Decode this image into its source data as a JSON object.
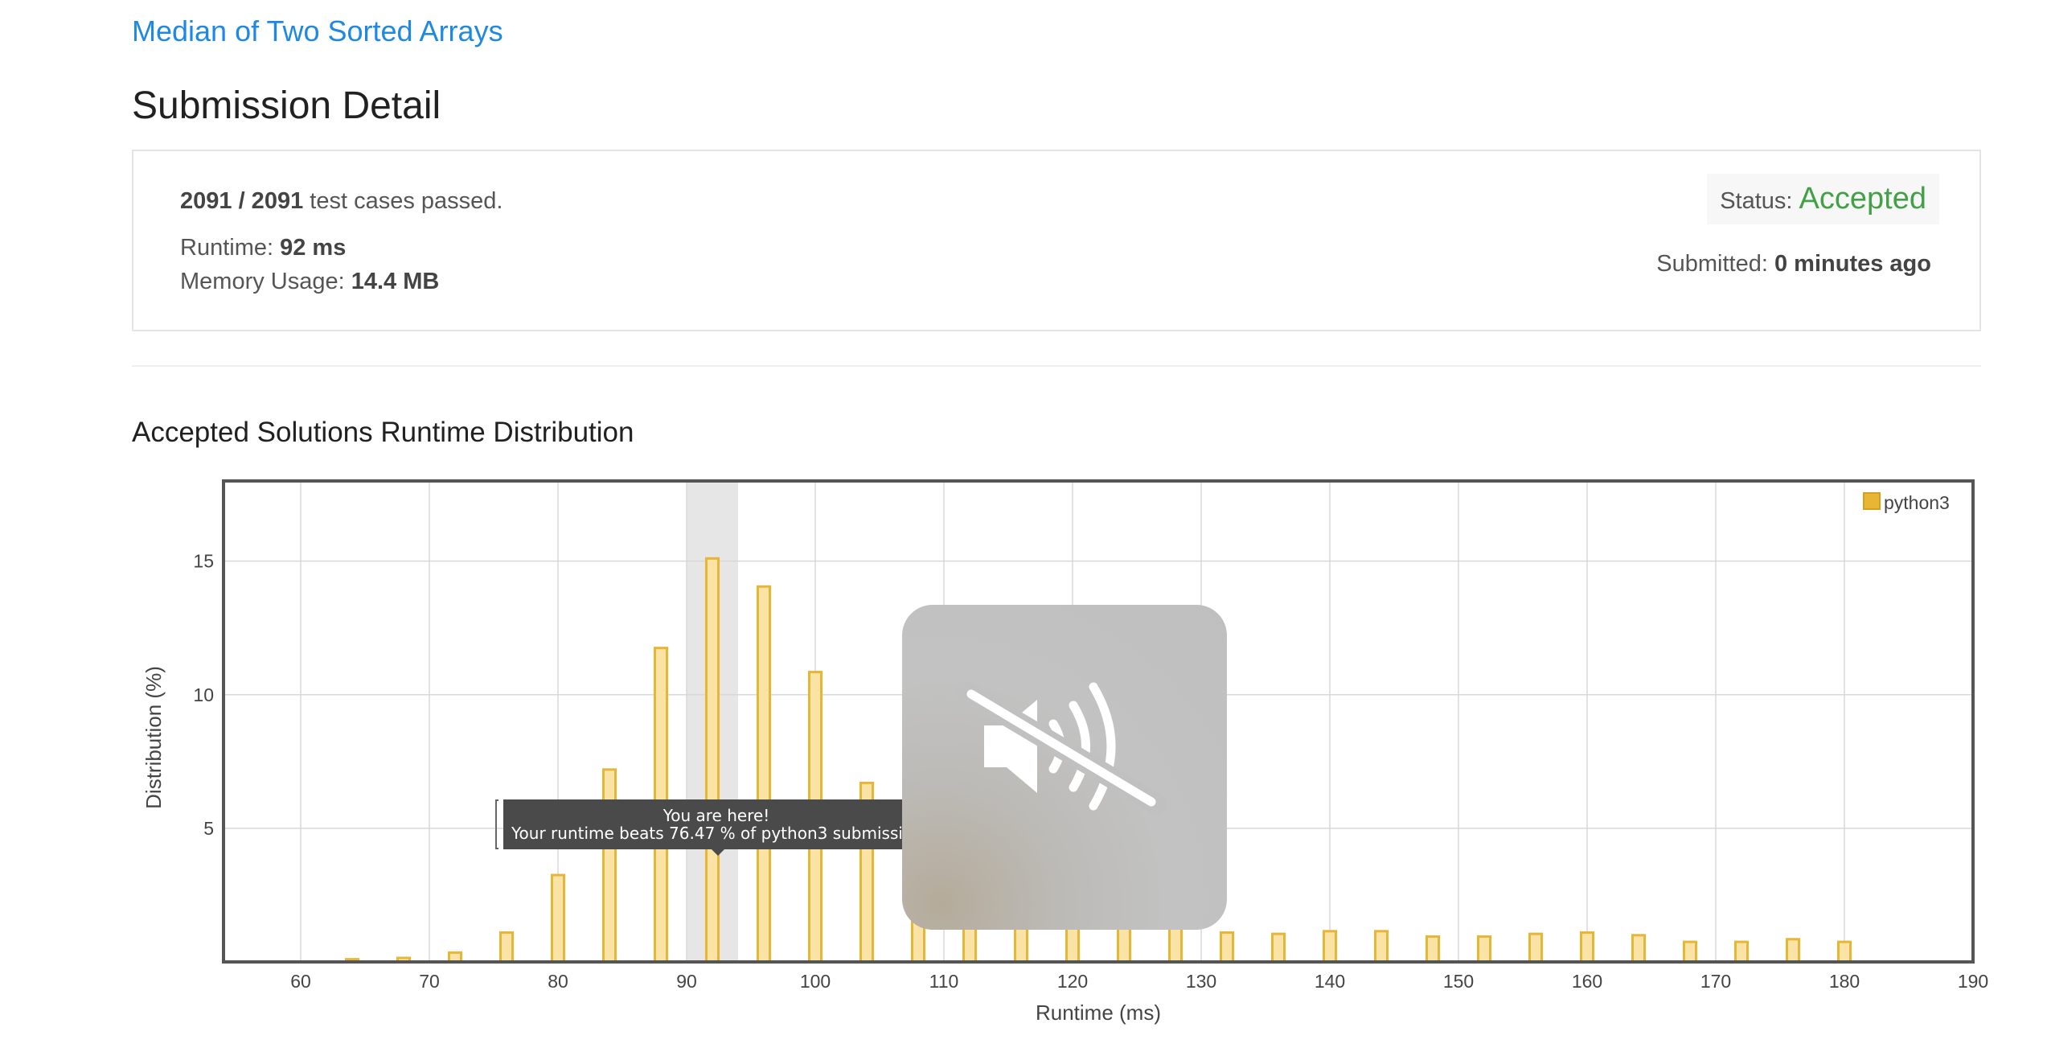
{
  "problem_title": "Median of Two Sorted Arrays",
  "page_title": "Submission Detail",
  "submission": {
    "tests_passed": "2091 / 2091",
    "tests_suffix": "test cases passed.",
    "runtime_label": "Runtime:",
    "runtime_value": "92 ms",
    "memory_label": "Memory Usage:",
    "memory_value": "14.4 MB",
    "status_label": "Status:",
    "status_value": "Accepted",
    "submitted_label": "Submitted:",
    "submitted_value": "0 minutes ago"
  },
  "section_title": "Accepted Solutions Runtime Distribution",
  "tooltip": {
    "line1": "You are here!",
    "line2": "Your runtime beats 76.47 % of python3 submissions."
  },
  "overlay": {
    "icon": "speaker-muted-icon"
  },
  "colors": {
    "bar_fill": "#fbe3a6",
    "bar_stroke": "#e8b535",
    "accent": "#1e88e5",
    "accepted": "#43a047"
  },
  "chart_data": {
    "type": "bar",
    "xlabel": "Runtime (ms)",
    "ylabel": "Distribution (%)",
    "xlim": [
      54,
      190
    ],
    "ylim": [
      0,
      18
    ],
    "x_ticks": [
      60,
      70,
      80,
      90,
      100,
      110,
      120,
      130,
      140,
      150,
      160,
      170,
      180,
      190
    ],
    "y_ticks": [
      5,
      10,
      15
    ],
    "grid": true,
    "legend_position": "top-right",
    "highlight_range": [
      90,
      94
    ],
    "series": [
      {
        "name": "python3",
        "x": [
          64,
          68,
          72,
          76,
          80,
          84,
          88,
          92,
          96,
          100,
          104,
          108,
          112,
          116,
          120,
          124,
          128,
          132,
          136,
          140,
          144,
          148,
          152,
          156,
          160,
          164,
          168,
          172,
          176,
          180
        ],
        "values": [
          0.1,
          0.15,
          0.35,
          1.1,
          3.25,
          7.2,
          11.75,
          15.1,
          14.05,
          10.85,
          6.7,
          2.6,
          2.2,
          2.0,
          1.85,
          1.6,
          1.4,
          1.1,
          1.05,
          1.15,
          1.15,
          0.95,
          0.95,
          1.05,
          1.1,
          1.0,
          0.75,
          0.75,
          0.85,
          0.75
        ]
      }
    ]
  }
}
